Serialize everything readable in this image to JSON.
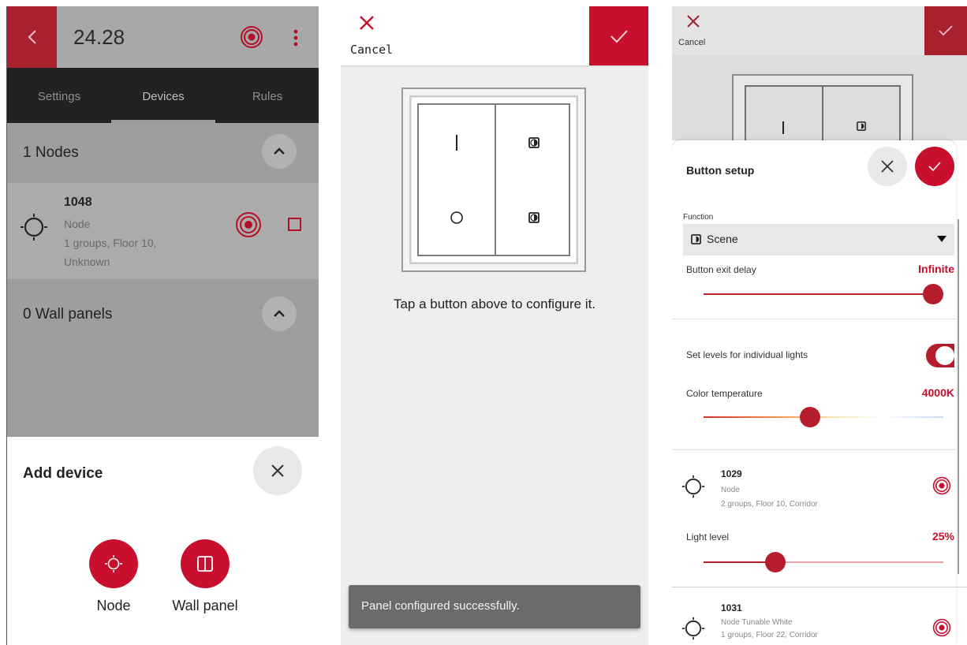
{
  "colors": {
    "accent": "#c8102e",
    "accent_dark": "#a9202f"
  },
  "screen1": {
    "title": "24.28",
    "tabs": [
      {
        "label": "Settings"
      },
      {
        "label": "Devices",
        "active": true
      },
      {
        "label": "Rules"
      }
    ],
    "nodes_section": "1 Nodes",
    "node": {
      "name": "1048",
      "type": "Node",
      "detail_line1": "1 groups, Floor 10,",
      "detail_line2": "Unknown"
    },
    "panels_section": "0 Wall panels",
    "sheet": {
      "title": "Add device",
      "options": [
        {
          "label": "Node",
          "icon": "light-icon"
        },
        {
          "label": "Wall panel",
          "icon": "wall-panel-icon"
        }
      ]
    }
  },
  "screen2": {
    "cancel_label": "Cancel",
    "hint": "Tap a button above to configure it.",
    "toast": "Panel configured successfully."
  },
  "screen3": {
    "cancel_label": "Cancel",
    "card_title": "Button setup",
    "function_label": "Function",
    "function_value": "Scene",
    "exit_delay_label": "Button exit delay",
    "exit_delay_value": "Infinite",
    "exit_delay_level": 1.0,
    "individual_label": "Set levels for individual lights",
    "individual_on": true,
    "color_temp_label": "Color temperature",
    "color_temp_value": "4000K",
    "color_temp_level": 0.44,
    "devices": [
      {
        "name": "1029",
        "type": "Node",
        "detail": "2 groups, Floor 10, Corridor"
      },
      {
        "name": "1031",
        "type": "Node Tunable White",
        "detail": "1 groups, Floor 22, Corridor"
      }
    ],
    "light_level_label": "Light level",
    "light_level_value": "25%",
    "light_level": 0.28
  }
}
